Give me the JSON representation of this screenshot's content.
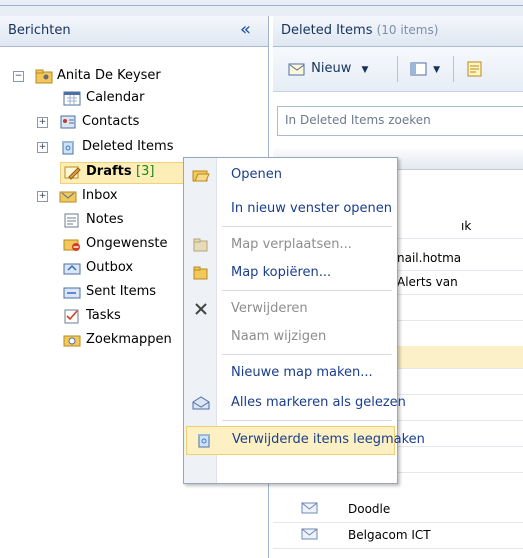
{
  "left_pane": {
    "header_title": "Berichten",
    "collapse_glyph": "«",
    "tree": [
      {
        "label": "Anita De Keyser",
        "icon": "folder-account-icon",
        "expander": "⊟"
      },
      {
        "label": "Calendar",
        "icon": "calendar-icon"
      },
      {
        "label": "Contacts",
        "icon": "contacts-icon",
        "expander": "⊞"
      },
      {
        "label": "Deleted Items",
        "icon": "recycle-bin-icon",
        "expander": "⊞"
      },
      {
        "label": "Drafts",
        "count": "[3]",
        "icon": "drafts-icon"
      },
      {
        "label": "Inbox",
        "icon": "inbox-icon",
        "expander": "⊞"
      },
      {
        "label": "Notes",
        "icon": "notes-icon"
      },
      {
        "label": "Ongewenste",
        "icon": "junk-icon"
      },
      {
        "label": "Outbox",
        "icon": "outbox-icon"
      },
      {
        "label": "Sent Items",
        "icon": "sent-items-icon"
      },
      {
        "label": "Tasks",
        "icon": "tasks-icon"
      },
      {
        "label": "Zoekmappen",
        "icon": "search-folder-icon"
      }
    ]
  },
  "right_pane": {
    "header_title": "Deleted Items",
    "header_count": "(10 items)",
    "toolbar": {
      "new_label": "Nieuw"
    },
    "search_placeholder": "In Deleted Items zoeken",
    "visible_fragments": [
      "ık",
      "nail.hotma",
      "Alerts van"
    ],
    "messages": [
      {
        "sender": "Doodle"
      },
      {
        "sender": "Belgacom ICT"
      }
    ]
  },
  "context_menu": {
    "items": [
      {
        "label": "Openen",
        "icon": "open-folder-icon",
        "enabled": true
      },
      {
        "label": "In nieuw venster openen",
        "icon": "",
        "enabled": true
      },
      {
        "label": "Map verplaatsen...",
        "icon": "move-folder-icon",
        "enabled": false
      },
      {
        "label": "Map kopiëren...",
        "icon": "copy-folder-icon",
        "enabled": true
      },
      {
        "label": "Verwijderen",
        "icon": "delete-x-icon",
        "enabled": false
      },
      {
        "label": "Naam wijzigen",
        "icon": "",
        "enabled": false
      },
      {
        "label": "Nieuwe map maken...",
        "icon": "",
        "enabled": true
      },
      {
        "label": "Alles markeren als gelezen",
        "icon": "envelope-read-icon",
        "enabled": true
      },
      {
        "label": "Verwijderde items leegmaken",
        "icon": "recycle-bin-icon",
        "enabled": true,
        "hover": true
      }
    ]
  },
  "colors": {
    "accent": "#1a3e8c",
    "hover_bg": "#fdf1c4",
    "selected_bg": "#fdeeb8",
    "count_green": "#1a8a1a"
  }
}
